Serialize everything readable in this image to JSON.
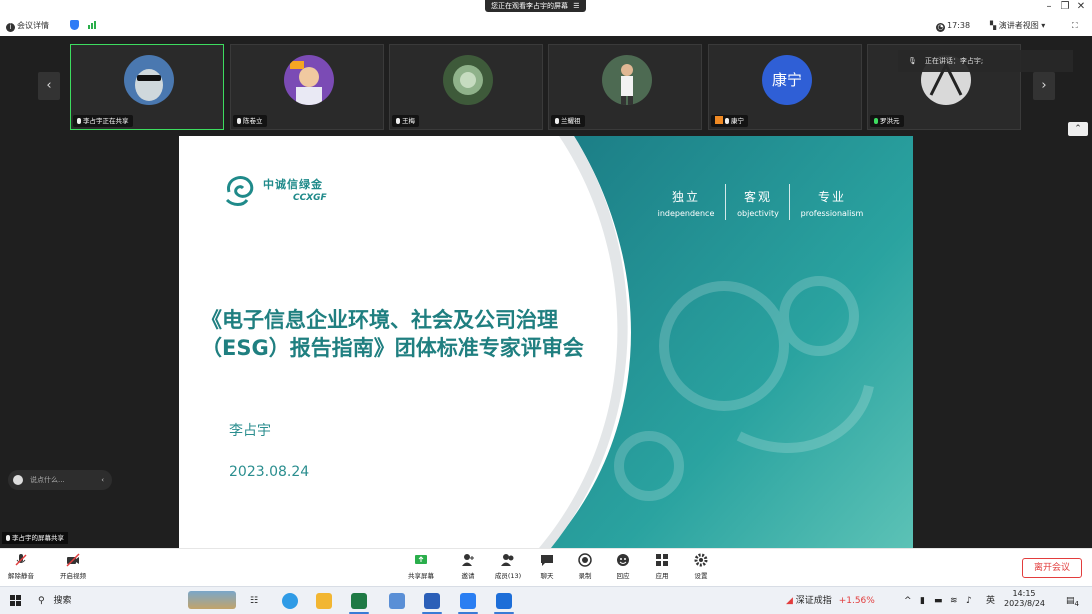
{
  "title_bar": {
    "share_banner": "您正在观看李占宇的屏幕"
  },
  "info_bar": {
    "meeting_details": "会议详情",
    "time": "17:38",
    "view_mode": "演讲者视图"
  },
  "participants": [
    {
      "name": "李占宇正在共享",
      "color": "#cfd8dc"
    },
    {
      "name": "陈卷立",
      "color": "#7b4bb5"
    },
    {
      "name": "王梅",
      "color": "#6f8f6a"
    },
    {
      "name": "兰耀祖",
      "color": "#4d6a52"
    },
    {
      "name": "康宁",
      "color": "#2f5fd6",
      "initial": "康宁"
    },
    {
      "name": "罗洪元",
      "color": "#d9d9d9"
    }
  ],
  "speaking_now": "正在讲话：李占宇;",
  "slide": {
    "logo_cn": "中诚信绿金",
    "logo_en": "CCXGF",
    "slogans": [
      {
        "cn": "独立",
        "en": "independence"
      },
      {
        "cn": "客观",
        "en": "objectivity"
      },
      {
        "cn": "专业",
        "en": "professionalism"
      }
    ],
    "title_line1": "《电子信息企业环境、社会及公司治理",
    "title_line2": "（ESG）报告指南》团体标准专家评审会",
    "author": "李占宇",
    "date": "2023.08.24"
  },
  "chat_placeholder": "说点什么...",
  "share_tag": "李占宇的屏幕共享",
  "toolbar": {
    "unmute": "解除静音",
    "start_video": "开启视频",
    "share_screen": "共享屏幕",
    "invite": "邀请",
    "members": "成员(13)",
    "chat": "聊天",
    "record": "录制",
    "reactions": "回应",
    "apps": "应用",
    "settings": "设置",
    "end_meeting": "离开会议"
  },
  "taskbar": {
    "search": "搜索",
    "stock_name": "深证成指",
    "stock_change": "+1.56%",
    "ime": "英",
    "clock_time": "14:15",
    "clock_date": "2023/8/24",
    "notifications": "4"
  },
  "colors": {
    "accent_teal": "#1f8a8a",
    "active_green": "#3ddc5f",
    "end_red": "#e23d3d"
  }
}
